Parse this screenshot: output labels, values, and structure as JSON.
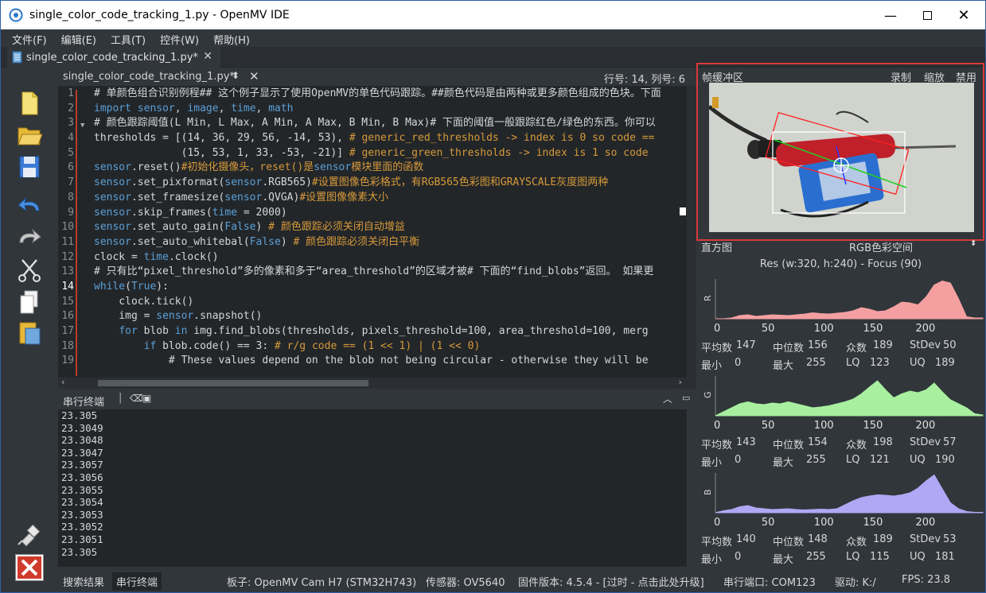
{
  "window": {
    "title": "single_color_code_tracking_1.py - OpenMV IDE"
  },
  "menu": [
    "文件(F)",
    "编辑(E)",
    "工具(T)",
    "控件(W)",
    "帮助(H)"
  ],
  "file_tab": {
    "label": "single_color_code_tracking_1.py*"
  },
  "editor": {
    "file_name": "single_color_code_tracking_1.py*",
    "cursor_position": "行号: 14, 列号: 6",
    "line_numbers": [
      "1",
      "2",
      "3",
      "4",
      "5",
      "6",
      "7",
      "8",
      "9",
      "10",
      "11",
      "12",
      "13",
      "14",
      "15",
      "16",
      "17",
      "18",
      "19"
    ],
    "lines": [
      "# 单颜色组合识别例程## 这个例子显示了使用OpenMV的单色代码跟踪。##颜色代码是由两种或更多颜色组成的色块。下面",
      "import sensor, image, time, math",
      "# 颜色跟踪阈值(L Min, L Max, A Min, A Max, B Min, B Max)# 下面的阈值一般跟踪红色/绿色的东西。你可以",
      "thresholds = [(14, 36, 29, 56, -14, 53), # generic_red_thresholds -> index is 0 so code ==",
      "              (15, 53, 1, 33, -53, -21)] # generic_green_thresholds -> index is 1 so code",
      "sensor.reset()#初始化摄像头，reset()是sensor模块里面的函数",
      "sensor.set_pixformat(sensor.RGB565)#设置图像色彩格式，有RGB565色彩图和GRAYSCALE灰度图两种",
      "sensor.set_framesize(sensor.QVGA)#设置图像像素大小",
      "sensor.skip_frames(time = 2000)",
      "sensor.set_auto_gain(False) # 颜色跟踪必须关闭自动增益",
      "sensor.set_auto_whitebal(False) # 颜色跟踪必须关闭白平衡",
      "clock = time.clock()",
      "# 只有比“pixel_threshold”多的像素和多于“area_threshold”的区域才被# 下面的“find_blobs”返回。 如果更",
      "while(True):",
      "    clock.tick()",
      "    img = sensor.snapshot()",
      "    for blob in img.find_blobs(thresholds, pixels_threshold=100, area_threshold=100, merg",
      "        if blob.code() == 3: # r/g code == (1 << 1) | (1 << 0)",
      "            # These values depend on the blob not being circular - otherwise they will be"
    ]
  },
  "serial_terminal": {
    "label": "串行终端",
    "lines": [
      "23.305",
      "23.3049",
      "23.3048",
      "23.3047",
      "23.3057",
      "23.3056",
      "23.3055",
      "23.3054",
      "23.3053",
      "23.3052",
      "23.3051",
      "23.305"
    ]
  },
  "status": {
    "tab_search": "搜索结果",
    "tab_serial": "串行终端",
    "board": "板子: OpenMV Cam H7 (STM32H743)",
    "sensor": "传感器: OV5640",
    "firmware": "固件版本: 4.5.4 - [过时 - 点击此处升级]",
    "port": "串行端口: COM123",
    "drive": "驱动: K:/",
    "fps": "FPS: 23.8"
  },
  "framebuffer": {
    "label": "帧缓冲区",
    "record": "录制",
    "zoom": "缩放",
    "disable": "禁用"
  },
  "histogram": {
    "label": "直方图",
    "colorspace": "RGB色彩空间",
    "resolution": "Res (w:320, h:240) - Focus (90)",
    "x_ticks": [
      "0",
      "50",
      "100",
      "150",
      "200"
    ],
    "channels": [
      {
        "name": "R",
        "color": "#f4a0a0",
        "mean": "147",
        "median": "156",
        "mode": "189",
        "stdev": "50",
        "min": "0",
        "max": "255",
        "lq": "123",
        "uq": "189",
        "shape": [
          0,
          0,
          0.02,
          0.08,
          0.1,
          0.06,
          0.08,
          0.1,
          0.09,
          0.08,
          0.1,
          0.12,
          0.15,
          0.13,
          0.12,
          0.14,
          0.16,
          0.2,
          0.28,
          0.24,
          0.18,
          0.2,
          0.3,
          0.42,
          0.4,
          0.35,
          0.55,
          0.85,
          0.95,
          0.9,
          0.5,
          0.05,
          0.02,
          0.02
        ]
      },
      {
        "name": "G",
        "color": "#a8f0a0",
        "mean": "143",
        "median": "154",
        "mode": "198",
        "stdev": "57",
        "min": "0",
        "max": "255",
        "lq": "121",
        "uq": "190",
        "shape": [
          0,
          0.1,
          0.2,
          0.3,
          0.35,
          0.3,
          0.28,
          0.32,
          0.3,
          0.35,
          0.3,
          0.25,
          0.2,
          0.22,
          0.25,
          0.3,
          0.35,
          0.42,
          0.55,
          0.72,
          0.88,
          0.65,
          0.45,
          0.55,
          0.62,
          0.58,
          0.65,
          0.82,
          0.6,
          0.4,
          0.3,
          0.2,
          0.05,
          0.02
        ]
      },
      {
        "name": "B",
        "color": "#b0a8f4",
        "mean": "140",
        "median": "148",
        "mode": "189",
        "stdev": "53",
        "min": "0",
        "max": "255",
        "lq": "115",
        "uq": "181",
        "shape": [
          0,
          0.05,
          0.08,
          0.15,
          0.18,
          0.12,
          0.1,
          0.08,
          0.09,
          0.1,
          0.08,
          0.07,
          0.08,
          0.09,
          0.08,
          0.1,
          0.2,
          0.3,
          0.38,
          0.42,
          0.45,
          0.44,
          0.42,
          0.45,
          0.5,
          0.62,
          0.8,
          0.95,
          0.6,
          0.25,
          0.1,
          0.03,
          0.01,
          0.01
        ]
      }
    ],
    "stat_labels": {
      "mean": "平均数",
      "median": "中位数",
      "mode": "众数",
      "stdev": "StDev",
      "min": "最小",
      "max": "最大",
      "lq": "LQ",
      "uq": "UQ"
    }
  }
}
